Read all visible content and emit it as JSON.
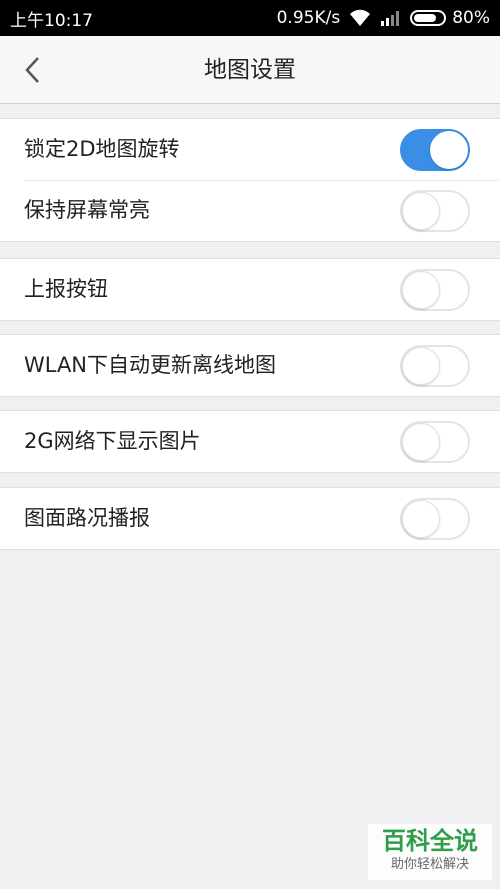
{
  "status_bar": {
    "time": "上午10:17",
    "network_speed": "0.95K/s",
    "battery_percent": "80%",
    "battery_level": 0.8
  },
  "nav": {
    "title": "地图设置",
    "back_icon": "chevron-left-icon"
  },
  "settings": {
    "lock_2d_rotation": {
      "label": "锁定2D地图旋转",
      "enabled": true
    },
    "keep_screen_on": {
      "label": "保持屏幕常亮",
      "enabled": false
    },
    "report_button": {
      "label": "上报按钮",
      "enabled": false
    },
    "wlan_auto_update": {
      "label": "WLAN下自动更新离线地图",
      "enabled": false
    },
    "show_images_2g": {
      "label": "2G网络下显示图片",
      "enabled": false
    },
    "traffic_broadcast": {
      "label": "图面路况播报",
      "enabled": false
    }
  },
  "colors": {
    "toggle_on": "#3a8ee6",
    "background": "#f0f0f2",
    "watermark_green": "#2e9e4a"
  },
  "watermark": {
    "title": "百科全说",
    "subtitle": "助你轻松解决"
  }
}
